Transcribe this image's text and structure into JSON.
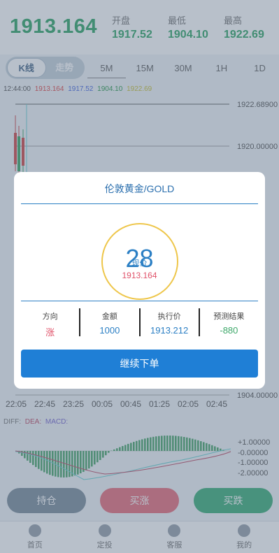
{
  "header": {
    "current_price": "1913.164",
    "open": {
      "label": "开盘",
      "value": "1917.52"
    },
    "low": {
      "label": "最低",
      "value": "1904.10"
    },
    "high": {
      "label": "最高",
      "value": "1922.69"
    }
  },
  "mode_tabs": [
    {
      "label": "K线",
      "active": true
    },
    {
      "label": "走势",
      "active": false
    }
  ],
  "period_tabs": [
    "5M",
    "15M",
    "30M",
    "1H",
    "1D"
  ],
  "chart_info": {
    "time": "12:44:00",
    "values": [
      "1913.164",
      "1917.52",
      "1904.10",
      "1922.69"
    ],
    "colors": [
      "#e04b4b",
      "#4b6be0",
      "#2e9a4e",
      "#c9c23a"
    ]
  },
  "y_axis_labels": [
    "1922.68900",
    "1920.00000",
    "1904.00000"
  ],
  "x_axis_labels": [
    "22:05",
    "22:45",
    "23:25",
    "00:05",
    "00:45",
    "01:25",
    "02:05",
    "02:45"
  ],
  "macd": {
    "labels": [
      {
        "text": "DIFF:",
        "color": "#777777"
      },
      {
        "text": "DEA:",
        "color": "#c0506a"
      },
      {
        "text": "MACD:",
        "color": "#7a6ad0"
      }
    ],
    "axis_labels": [
      "+1.00000",
      "-0.00000",
      "-1.00000",
      "-2.00000"
    ]
  },
  "actions": {
    "hold": "持仓",
    "buy_up": "买涨",
    "buy_down": "买跌",
    "colors": {
      "hold": "#7f8f9e",
      "buy_up": "#e8707e",
      "buy_down": "#3fb07a"
    }
  },
  "nav": [
    {
      "label": "首页",
      "icon": "home-icon"
    },
    {
      "label": "定投",
      "icon": "fixed-invest-icon"
    },
    {
      "label": "客服",
      "icon": "headset-icon"
    },
    {
      "label": "我的",
      "icon": "user-icon"
    }
  ],
  "modal": {
    "title": "伦敦黄金/GOLD",
    "countdown": "28",
    "current_label": "现价",
    "current_price": "1913.164",
    "direction": {
      "label": "方向",
      "value": "涨"
    },
    "amount": {
      "label": "金额",
      "value": "1000"
    },
    "exec_price": {
      "label": "执行价",
      "value": "1913.212"
    },
    "result": {
      "label": "预测结果",
      "value": "-880"
    },
    "continue_label": "继续下单"
  }
}
